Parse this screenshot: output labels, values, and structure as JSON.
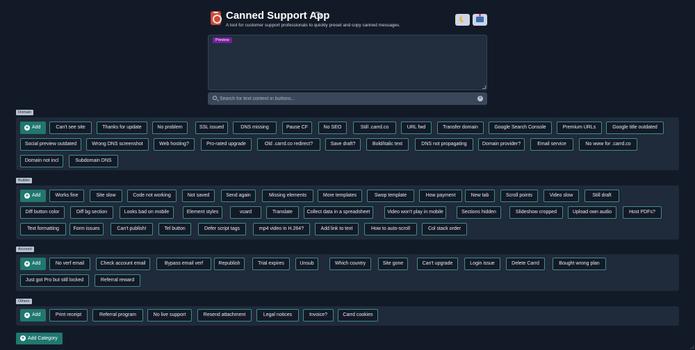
{
  "app": {
    "title": "Canned Support App",
    "subtitle": "A tool for customer support professionals to quickly preset and copy canned messages.",
    "info_icon": "info-icon",
    "theme_icon": "moon-icon",
    "save_icon": "inbox-tray-icon"
  },
  "preview": {
    "badge": "Preview"
  },
  "search": {
    "placeholder": "Search for text content in buttons..."
  },
  "add_label": "Add",
  "add_category_label": "Add Category",
  "colors": {
    "background": "#131a27",
    "panel": "#1f2a3a",
    "accent": "#20786f",
    "button_border": "#3e8d8b",
    "preview_badge": "#7a1fa0"
  },
  "categories": [
    {
      "name": "Domain",
      "buttons": [
        "Can't see site",
        "Thanks for update",
        "No problem",
        "SSL issued",
        "DNS missing",
        "Pause CF",
        "No SEO",
        "Still .carrd.co",
        "URL fwd",
        "Transfer domain",
        "Google Search Console",
        "Premium URLs",
        "Google title outdated",
        "Social preview outdated",
        "Wrong DNS screenshot",
        "Web hosting?",
        "Pro-rated upgrade",
        "Old .carrd.co redirect?",
        "Save draft?",
        "Bold/italic text",
        "DNS not propagating",
        "Domain provider?",
        "Email service",
        "No www for .carrd.co",
        "Domain not incl",
        "Subdomain DNS"
      ]
    },
    {
      "name": "Builder",
      "buttons": [
        "Works fine",
        "Site slow",
        "Code not working",
        "Not saved",
        "Send again",
        "Missing elements",
        "More templates",
        "Swop template",
        "How payment",
        "New tab",
        "Scroll points",
        "Video slow",
        "Still draft",
        "Diff button color",
        "Diff bg section",
        "Looks bad on mobile",
        "Element styles",
        "vcard",
        "Translate",
        "Collect data in a spreadsheet",
        "Video won't play in mobile",
        "Sections hidden",
        "Slideshow cropped",
        "Upload own audio",
        "Host PDFs?",
        "Text formatting",
        "Form issues",
        "Can't publish!",
        "Tel button",
        "Defer script tags",
        "mp4 video in H.264?",
        "Add link to text",
        "How to auto-scroll",
        "Col stack order"
      ]
    },
    {
      "name": "Account",
      "buttons": [
        "No verf email",
        "Check account email",
        "Bypass email verf",
        "Republish",
        "Trial expires",
        "Unsub",
        "Which country",
        "Site gone",
        "Can't upgrade",
        "Login issue",
        "Delete Carrd",
        "Bought wrong plan",
        "Just got Pro but still locked",
        "Referral reward"
      ]
    },
    {
      "name": "Others",
      "buttons": [
        "Print receipt",
        "Referral program",
        "No live support",
        "Resend attachment",
        "Legal notices",
        "Invoice?",
        "Carrd cookies"
      ]
    }
  ]
}
